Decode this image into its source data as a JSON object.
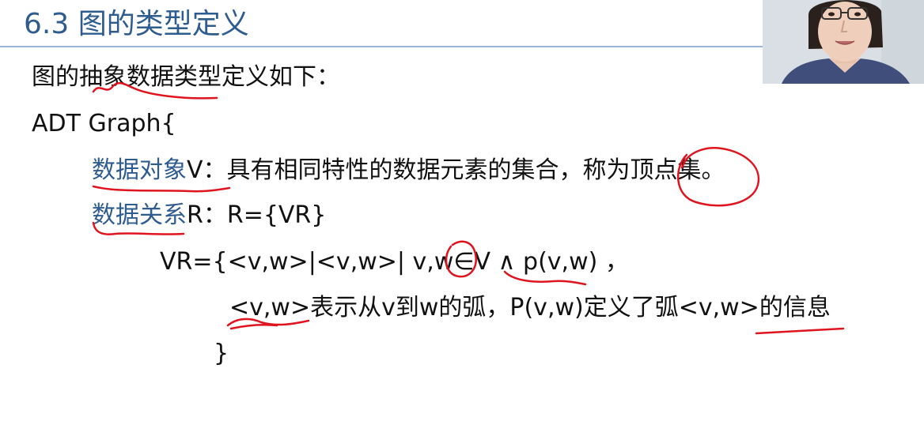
{
  "slide": {
    "title": "6.3 图的类型定义",
    "intro": "图的抽象数据类型定义如下：",
    "adt_open": "ADT Graph{",
    "data_object": {
      "term": "数据对象",
      "text": "V：具有相同特性的数据元素的集合，称为顶点集。"
    },
    "data_relation": {
      "term": "数据关系",
      "text": "R：R={VR}"
    },
    "vr_definition": "VR={<v,w>|<v,w>| v,w∈V ∧ p(v,w) ，",
    "vr_explanation": "<v,w>表示从v到w的弧，P(v,w)定义了弧<v,w>的信息",
    "closing_brace": "}"
  },
  "colors": {
    "title": "#2f5c8f",
    "accent_term": "#2f5c8f",
    "body_text": "#111111",
    "rule": "#9cb4d3",
    "annotation": "#e0141e"
  }
}
